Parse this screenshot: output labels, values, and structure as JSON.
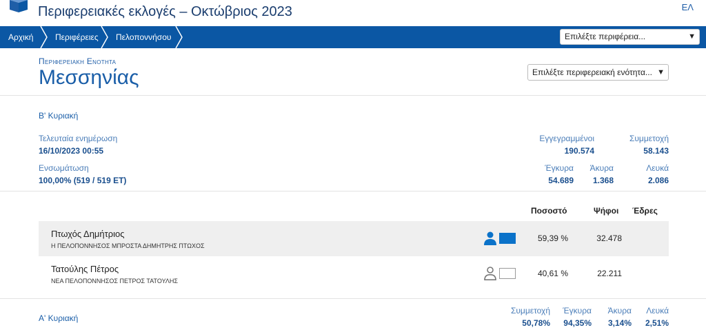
{
  "header": {
    "title": "Περιφερειακές εκλογές – Οκτώβριος 2023",
    "language": "ΕΛ"
  },
  "nav": {
    "crumbs": [
      "Αρχική",
      "Περιφέρειες",
      "Πελοποννήσου"
    ],
    "region_select": "Επιλέξτε περιφέρεια..."
  },
  "region": {
    "section_label": "Περιφερειακη Ενοτητα",
    "name": "Μεσσηνίας",
    "unit_select": "Επιλέξτε περιφερειακή ενότητα..."
  },
  "round_b": {
    "title": "Β' Κυριακή",
    "last_update_label": "Τελευταία ενημέρωση",
    "last_update_value": "16/10/2023 00:55",
    "integration_label": "Ενσωμάτωση",
    "integration_value": "100,00% (519 / 519 ΕΤ)",
    "registered_label": "Εγγεγραμμένοι",
    "registered_value": "190.574",
    "turnout_label": "Συμμετοχή",
    "turnout_value": "58.143",
    "valid_label": "Έγκυρα",
    "valid_value": "54.689",
    "invalid_label": "Άκυρα",
    "invalid_value": "1.368",
    "blank_label": "Λευκά",
    "blank_value": "2.086"
  },
  "results": {
    "headers": {
      "percent": "Ποσοστό",
      "votes": "Ψήφοι",
      "seats": "Έδρες"
    },
    "candidates": [
      {
        "name": "Πτωχός Δημήτριος",
        "party": "Η ΠΕΛΟΠΟΝΝΗΣΟΣ ΜΠΡΟΣΤΑ ΔΗΜΗΤΡΗΣ ΠΤΩΧΟΣ",
        "percent": "59,39 %",
        "votes": "32.478",
        "color": "#0b72c9",
        "winner": true
      },
      {
        "name": "Τατούλης Πέτρος",
        "party": "ΝΕΑ ΠΕΛΟΠΟΝΝΗΣΟΣ ΠΕΤΡΟΣ ΤΑΤΟΥΛΗΣ",
        "percent": "40,61 %",
        "votes": "22.211",
        "color": "#ffffff",
        "winner": false
      }
    ]
  },
  "round_a": {
    "title": "Α' Κυριακή",
    "turnout_label": "Συμμετοχή",
    "turnout_value": "50,78%",
    "valid_label": "Έγκυρα",
    "valid_value": "94,35%",
    "invalid_label": "Άκυρα",
    "invalid_value": "3,14%",
    "blank_label": "Λευκά",
    "blank_value": "2,51%"
  },
  "colors": {
    "brand": "#0b57a4",
    "accent": "#1a5ea8"
  }
}
